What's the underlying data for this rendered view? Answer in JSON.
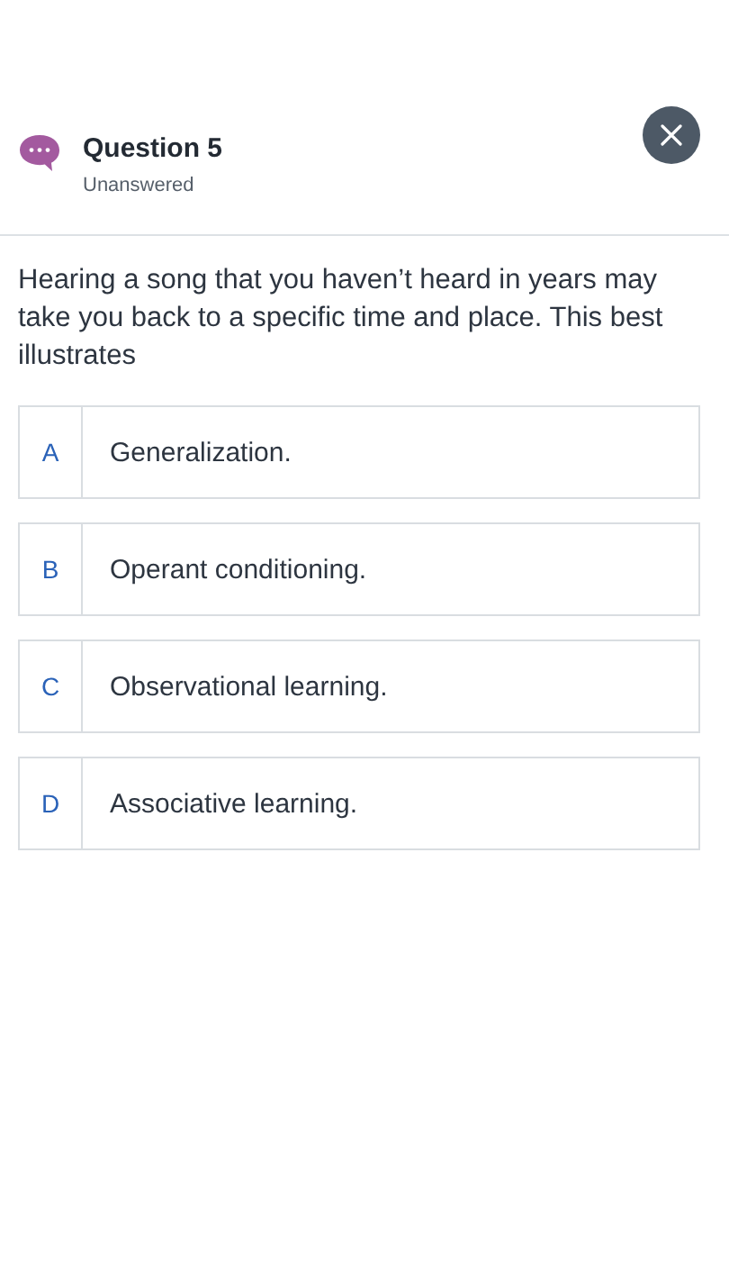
{
  "header": {
    "title": "Question 5",
    "status": "Unanswered"
  },
  "question": {
    "text": "Hearing a song that you haven’t heard in years may take you back to a specific time and place. This best illustrates"
  },
  "options": [
    {
      "letter": "A",
      "text": "Generalization."
    },
    {
      "letter": "B",
      "text": "Operant conditioning."
    },
    {
      "letter": "C",
      "text": "Observational learning."
    },
    {
      "letter": "D",
      "text": "Associative learning."
    }
  ]
}
